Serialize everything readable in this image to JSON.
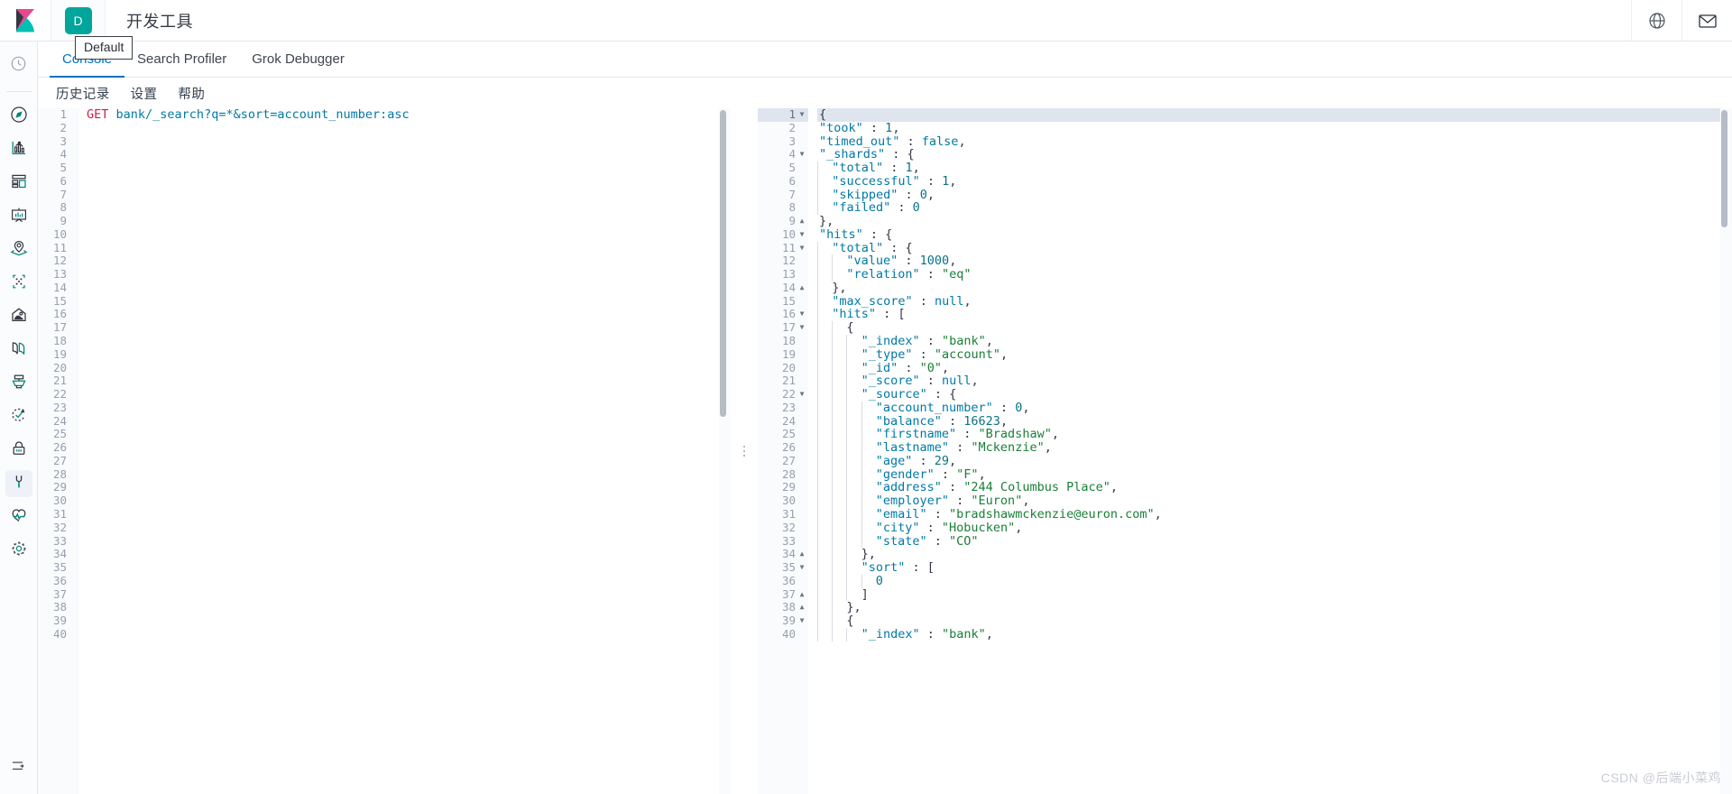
{
  "header": {
    "app_title": "开发工具",
    "space_badge": "D",
    "logo_icon": "kibana-logo-icon",
    "globe_icon": "globe-help-icon",
    "mail_icon": "mail-news-icon"
  },
  "tooltip": {
    "text": "Default"
  },
  "rail": {
    "items": [
      {
        "icon": "recently-viewed-clock-icon",
        "name": "recently-viewed",
        "active": false,
        "separator_after": true
      },
      {
        "icon": "discover-compass-icon",
        "name": "discover",
        "active": false
      },
      {
        "icon": "visualize-chart-icon",
        "name": "visualize",
        "active": false
      },
      {
        "icon": "dashboard-grid-icon",
        "name": "dashboard",
        "active": false
      },
      {
        "icon": "canvas-presentation-icon",
        "name": "canvas",
        "active": false
      },
      {
        "icon": "maps-location-icon",
        "name": "maps",
        "active": false
      },
      {
        "icon": "machine-learning-nodes-icon",
        "name": "machine-learning",
        "active": false
      },
      {
        "icon": "infrastructure-hill-icon",
        "name": "infrastructure",
        "active": false
      },
      {
        "icon": "logs-pages-icon",
        "name": "logs",
        "active": false
      },
      {
        "icon": "apm-rack-icon",
        "name": "apm",
        "active": false
      },
      {
        "icon": "uptime-check-arrow-icon",
        "name": "uptime",
        "active": false
      },
      {
        "icon": "siem-lock-icon",
        "name": "siem",
        "active": false
      },
      {
        "icon": "dev-tools-wrench-icon",
        "name": "dev-tools",
        "active": true
      },
      {
        "icon": "monitoring-heartbeat-icon",
        "name": "monitoring",
        "active": false
      },
      {
        "icon": "management-gear-icon",
        "name": "management",
        "active": false
      }
    ],
    "collapse_icon": "collapse-arrow-icon"
  },
  "tabs": [
    {
      "label": "Console",
      "active": true
    },
    {
      "label": "Search Profiler",
      "active": false
    },
    {
      "label": "Grok Debugger",
      "active": false
    }
  ],
  "submenu": [
    {
      "label": "历史记录"
    },
    {
      "label": "设置"
    },
    {
      "label": "帮助"
    }
  ],
  "request_editor": {
    "total_lines": 40,
    "current_line": 1,
    "line1": {
      "method": "GET",
      "path": "bank/_search?q=*&sort=account_number:asc"
    }
  },
  "response_editor": {
    "current_line": 1,
    "lines": [
      {
        "n": 1,
        "fold": "down",
        "indent": 0,
        "content": [
          {
            "t": "p",
            "v": "{"
          }
        ]
      },
      {
        "n": 2,
        "fold": "",
        "indent": 0,
        "content": [
          {
            "t": "k",
            "v": "\"took\""
          },
          {
            "t": "p",
            "v": " : "
          },
          {
            "t": "n",
            "v": "1"
          },
          {
            "t": "p",
            "v": ","
          }
        ]
      },
      {
        "n": 3,
        "fold": "",
        "indent": 0,
        "content": [
          {
            "t": "k",
            "v": "\"timed_out\""
          },
          {
            "t": "p",
            "v": " : "
          },
          {
            "t": "b",
            "v": "false"
          },
          {
            "t": "p",
            "v": ","
          }
        ]
      },
      {
        "n": 4,
        "fold": "down",
        "indent": 0,
        "content": [
          {
            "t": "k",
            "v": "\"_shards\""
          },
          {
            "t": "p",
            "v": " : {"
          }
        ]
      },
      {
        "n": 5,
        "fold": "",
        "indent": 1,
        "content": [
          {
            "t": "k",
            "v": "\"total\""
          },
          {
            "t": "p",
            "v": " : "
          },
          {
            "t": "n",
            "v": "1"
          },
          {
            "t": "p",
            "v": ","
          }
        ]
      },
      {
        "n": 6,
        "fold": "",
        "indent": 1,
        "content": [
          {
            "t": "k",
            "v": "\"successful\""
          },
          {
            "t": "p",
            "v": " : "
          },
          {
            "t": "n",
            "v": "1"
          },
          {
            "t": "p",
            "v": ","
          }
        ]
      },
      {
        "n": 7,
        "fold": "",
        "indent": 1,
        "content": [
          {
            "t": "k",
            "v": "\"skipped\""
          },
          {
            "t": "p",
            "v": " : "
          },
          {
            "t": "n",
            "v": "0"
          },
          {
            "t": "p",
            "v": ","
          }
        ]
      },
      {
        "n": 8,
        "fold": "",
        "indent": 1,
        "content": [
          {
            "t": "k",
            "v": "\"failed\""
          },
          {
            "t": "p",
            "v": " : "
          },
          {
            "t": "n",
            "v": "0"
          }
        ]
      },
      {
        "n": 9,
        "fold": "up",
        "indent": 0,
        "content": [
          {
            "t": "p",
            "v": "},"
          }
        ]
      },
      {
        "n": 10,
        "fold": "down",
        "indent": 0,
        "content": [
          {
            "t": "k",
            "v": "\"hits\""
          },
          {
            "t": "p",
            "v": " : {"
          }
        ]
      },
      {
        "n": 11,
        "fold": "down",
        "indent": 1,
        "content": [
          {
            "t": "k",
            "v": "\"total\""
          },
          {
            "t": "p",
            "v": " : {"
          }
        ]
      },
      {
        "n": 12,
        "fold": "",
        "indent": 2,
        "content": [
          {
            "t": "k",
            "v": "\"value\""
          },
          {
            "t": "p",
            "v": " : "
          },
          {
            "t": "n",
            "v": "1000"
          },
          {
            "t": "p",
            "v": ","
          }
        ]
      },
      {
        "n": 13,
        "fold": "",
        "indent": 2,
        "content": [
          {
            "t": "k",
            "v": "\"relation\""
          },
          {
            "t": "p",
            "v": " : "
          },
          {
            "t": "s",
            "v": "\"eq\""
          }
        ]
      },
      {
        "n": 14,
        "fold": "up",
        "indent": 1,
        "content": [
          {
            "t": "p",
            "v": "},"
          }
        ]
      },
      {
        "n": 15,
        "fold": "",
        "indent": 1,
        "content": [
          {
            "t": "k",
            "v": "\"max_score\""
          },
          {
            "t": "p",
            "v": " : "
          },
          {
            "t": "b",
            "v": "null"
          },
          {
            "t": "p",
            "v": ","
          }
        ]
      },
      {
        "n": 16,
        "fold": "down",
        "indent": 1,
        "content": [
          {
            "t": "k",
            "v": "\"hits\""
          },
          {
            "t": "p",
            "v": " : ["
          }
        ]
      },
      {
        "n": 17,
        "fold": "down",
        "indent": 2,
        "content": [
          {
            "t": "p",
            "v": "{"
          }
        ]
      },
      {
        "n": 18,
        "fold": "",
        "indent": 3,
        "content": [
          {
            "t": "k",
            "v": "\"_index\""
          },
          {
            "t": "p",
            "v": " : "
          },
          {
            "t": "s",
            "v": "\"bank\""
          },
          {
            "t": "p",
            "v": ","
          }
        ]
      },
      {
        "n": 19,
        "fold": "",
        "indent": 3,
        "content": [
          {
            "t": "k",
            "v": "\"_type\""
          },
          {
            "t": "p",
            "v": " : "
          },
          {
            "t": "s",
            "v": "\"account\""
          },
          {
            "t": "p",
            "v": ","
          }
        ]
      },
      {
        "n": 20,
        "fold": "",
        "indent": 3,
        "content": [
          {
            "t": "k",
            "v": "\"_id\""
          },
          {
            "t": "p",
            "v": " : "
          },
          {
            "t": "s",
            "v": "\"0\""
          },
          {
            "t": "p",
            "v": ","
          }
        ]
      },
      {
        "n": 21,
        "fold": "",
        "indent": 3,
        "content": [
          {
            "t": "k",
            "v": "\"_score\""
          },
          {
            "t": "p",
            "v": " : "
          },
          {
            "t": "b",
            "v": "null"
          },
          {
            "t": "p",
            "v": ","
          }
        ]
      },
      {
        "n": 22,
        "fold": "down",
        "indent": 3,
        "content": [
          {
            "t": "k",
            "v": "\"_source\""
          },
          {
            "t": "p",
            "v": " : {"
          }
        ]
      },
      {
        "n": 23,
        "fold": "",
        "indent": 4,
        "content": [
          {
            "t": "k",
            "v": "\"account_number\""
          },
          {
            "t": "p",
            "v": " : "
          },
          {
            "t": "n",
            "v": "0"
          },
          {
            "t": "p",
            "v": ","
          }
        ]
      },
      {
        "n": 24,
        "fold": "",
        "indent": 4,
        "content": [
          {
            "t": "k",
            "v": "\"balance\""
          },
          {
            "t": "p",
            "v": " : "
          },
          {
            "t": "n",
            "v": "16623"
          },
          {
            "t": "p",
            "v": ","
          }
        ]
      },
      {
        "n": 25,
        "fold": "",
        "indent": 4,
        "content": [
          {
            "t": "k",
            "v": "\"firstname\""
          },
          {
            "t": "p",
            "v": " : "
          },
          {
            "t": "s",
            "v": "\"Bradshaw\""
          },
          {
            "t": "p",
            "v": ","
          }
        ]
      },
      {
        "n": 26,
        "fold": "",
        "indent": 4,
        "content": [
          {
            "t": "k",
            "v": "\"lastname\""
          },
          {
            "t": "p",
            "v": " : "
          },
          {
            "t": "s",
            "v": "\"Mckenzie\""
          },
          {
            "t": "p",
            "v": ","
          }
        ]
      },
      {
        "n": 27,
        "fold": "",
        "indent": 4,
        "content": [
          {
            "t": "k",
            "v": "\"age\""
          },
          {
            "t": "p",
            "v": " : "
          },
          {
            "t": "n",
            "v": "29"
          },
          {
            "t": "p",
            "v": ","
          }
        ]
      },
      {
        "n": 28,
        "fold": "",
        "indent": 4,
        "content": [
          {
            "t": "k",
            "v": "\"gender\""
          },
          {
            "t": "p",
            "v": " : "
          },
          {
            "t": "s",
            "v": "\"F\""
          },
          {
            "t": "p",
            "v": ","
          }
        ]
      },
      {
        "n": 29,
        "fold": "",
        "indent": 4,
        "content": [
          {
            "t": "k",
            "v": "\"address\""
          },
          {
            "t": "p",
            "v": " : "
          },
          {
            "t": "s",
            "v": "\"244 Columbus Place\""
          },
          {
            "t": "p",
            "v": ","
          }
        ]
      },
      {
        "n": 30,
        "fold": "",
        "indent": 4,
        "content": [
          {
            "t": "k",
            "v": "\"employer\""
          },
          {
            "t": "p",
            "v": " : "
          },
          {
            "t": "s",
            "v": "\"Euron\""
          },
          {
            "t": "p",
            "v": ","
          }
        ]
      },
      {
        "n": 31,
        "fold": "",
        "indent": 4,
        "content": [
          {
            "t": "k",
            "v": "\"email\""
          },
          {
            "t": "p",
            "v": " : "
          },
          {
            "t": "s",
            "v": "\"bradshawmckenzie@euron.com\""
          },
          {
            "t": "p",
            "v": ","
          }
        ]
      },
      {
        "n": 32,
        "fold": "",
        "indent": 4,
        "content": [
          {
            "t": "k",
            "v": "\"city\""
          },
          {
            "t": "p",
            "v": " : "
          },
          {
            "t": "s",
            "v": "\"Hobucken\""
          },
          {
            "t": "p",
            "v": ","
          }
        ]
      },
      {
        "n": 33,
        "fold": "",
        "indent": 4,
        "content": [
          {
            "t": "k",
            "v": "\"state\""
          },
          {
            "t": "p",
            "v": " : "
          },
          {
            "t": "s",
            "v": "\"CO\""
          }
        ]
      },
      {
        "n": 34,
        "fold": "up",
        "indent": 3,
        "content": [
          {
            "t": "p",
            "v": "},"
          }
        ]
      },
      {
        "n": 35,
        "fold": "down",
        "indent": 3,
        "content": [
          {
            "t": "k",
            "v": "\"sort\""
          },
          {
            "t": "p",
            "v": " : ["
          }
        ]
      },
      {
        "n": 36,
        "fold": "",
        "indent": 4,
        "content": [
          {
            "t": "n",
            "v": "0"
          }
        ]
      },
      {
        "n": 37,
        "fold": "up",
        "indent": 3,
        "content": [
          {
            "t": "p",
            "v": "]"
          }
        ]
      },
      {
        "n": 38,
        "fold": "up",
        "indent": 2,
        "content": [
          {
            "t": "p",
            "v": "},"
          }
        ]
      },
      {
        "n": 39,
        "fold": "down",
        "indent": 2,
        "content": [
          {
            "t": "p",
            "v": "{"
          }
        ]
      },
      {
        "n": 40,
        "fold": "",
        "indent": 3,
        "content": [
          {
            "t": "k",
            "v": "\"_index\""
          },
          {
            "t": "p",
            "v": " : "
          },
          {
            "t": "s",
            "v": "\"bank\""
          },
          {
            "t": "p",
            "v": ","
          }
        ]
      }
    ]
  },
  "watermark": {
    "text": "CSDN @后端小菜鸡"
  },
  "colors": {
    "accent": "#0071c2",
    "space_badge": "#00a69b",
    "key": "#0079a5",
    "string": "#1a7f37",
    "method": "#c7254e",
    "selection": "#dfe5ef"
  }
}
